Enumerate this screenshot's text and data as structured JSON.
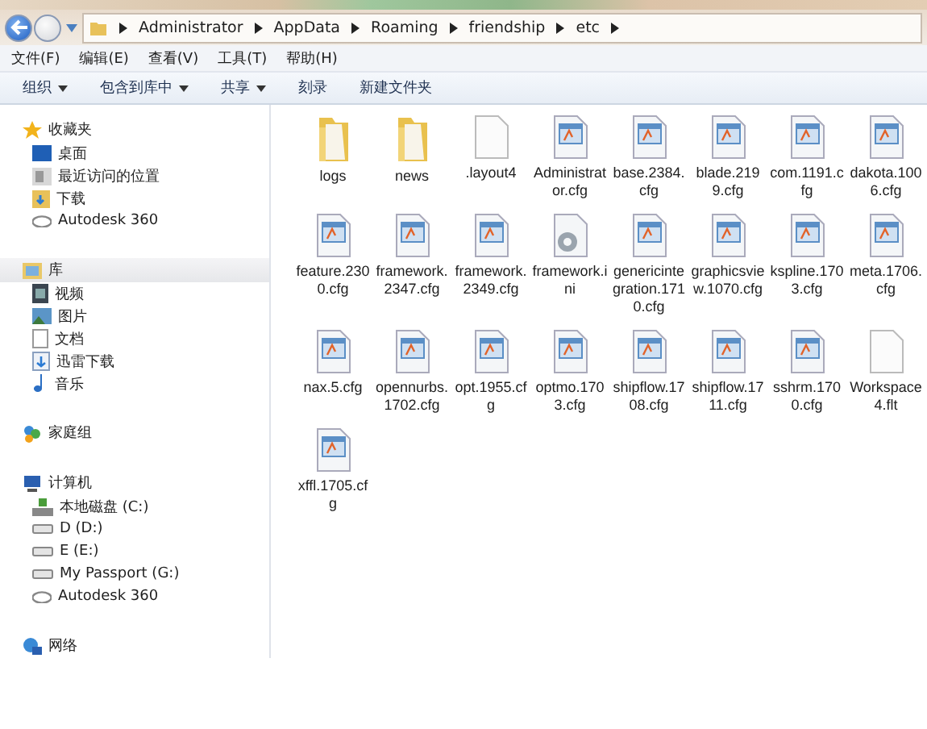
{
  "address_bar": {
    "segments": [
      "Administrator",
      "AppData",
      "Roaming",
      "friendship",
      "etc"
    ]
  },
  "menu_bar": [
    "文件(F)",
    "编辑(E)",
    "查看(V)",
    "工具(T)",
    "帮助(H)"
  ],
  "toolbar": [
    {
      "label": "组织",
      "dropdown": true
    },
    {
      "label": "包含到库中",
      "dropdown": true
    },
    {
      "label": "共享",
      "dropdown": true
    },
    {
      "label": "刻录",
      "dropdown": false
    },
    {
      "label": "新建文件夹",
      "dropdown": false
    }
  ],
  "sidebar": {
    "groups": [
      {
        "label": "收藏夹",
        "kind": "star",
        "selected": false,
        "children": [
          {
            "label": "桌面",
            "kind": "desktop"
          },
          {
            "label": "最近访问的位置",
            "kind": "recent"
          },
          {
            "label": "下载",
            "kind": "download"
          },
          {
            "label": "Autodesk 360",
            "kind": "cloud"
          }
        ]
      },
      {
        "label": "库",
        "kind": "library",
        "selected": true,
        "children": [
          {
            "label": "视频",
            "kind": "video"
          },
          {
            "label": "图片",
            "kind": "image"
          },
          {
            "label": "文档",
            "kind": "doc"
          },
          {
            "label": "迅雷下载",
            "kind": "download2"
          },
          {
            "label": "音乐",
            "kind": "music"
          }
        ]
      },
      {
        "label": "家庭组",
        "kind": "homegroup",
        "selected": false
      },
      {
        "label": "计算机",
        "kind": "computer",
        "selected": false,
        "children": [
          {
            "label": "本地磁盘 (C:)",
            "kind": "sysdrive"
          },
          {
            "label": "D (D:)",
            "kind": "drive"
          },
          {
            "label": "E (E:)",
            "kind": "drive"
          },
          {
            "label": "My Passport (G:)",
            "kind": "drive"
          },
          {
            "label": "Autodesk 360",
            "kind": "cloud"
          }
        ]
      },
      {
        "label": "网络",
        "kind": "network",
        "selected": false
      }
    ]
  },
  "files": [
    {
      "name": "logs",
      "kind": "folder"
    },
    {
      "name": "news",
      "kind": "folder"
    },
    {
      "name": ".layout4",
      "kind": "blank"
    },
    {
      "name": "Administrator.cfg",
      "kind": "cfg"
    },
    {
      "name": "base.2384.cfg",
      "kind": "cfg"
    },
    {
      "name": "blade.2199.cfg",
      "kind": "cfg"
    },
    {
      "name": "com.1191.cfg",
      "kind": "cfg"
    },
    {
      "name": "dakota.1006.cfg",
      "kind": "cfg"
    },
    {
      "name": "feature.2300.cfg",
      "kind": "cfg"
    },
    {
      "name": "framework.2347.cfg",
      "kind": "cfg"
    },
    {
      "name": "framework.2349.cfg",
      "kind": "cfg"
    },
    {
      "name": "framework.ini",
      "kind": "ini"
    },
    {
      "name": "genericintegration.1710.cfg",
      "kind": "cfg"
    },
    {
      "name": "graphicsview.1070.cfg",
      "kind": "cfg"
    },
    {
      "name": "kspline.1703.cfg",
      "kind": "cfg"
    },
    {
      "name": "meta.1706.cfg",
      "kind": "cfg"
    },
    {
      "name": "nax.5.cfg",
      "kind": "cfg"
    },
    {
      "name": "opennurbs.1702.cfg",
      "kind": "cfg"
    },
    {
      "name": "opt.1955.cfg",
      "kind": "cfg"
    },
    {
      "name": "optmo.1703.cfg",
      "kind": "cfg"
    },
    {
      "name": "shipflow.1708.cfg",
      "kind": "cfg"
    },
    {
      "name": "shipflow.1711.cfg",
      "kind": "cfg"
    },
    {
      "name": "sshrm.1700.cfg",
      "kind": "cfg"
    },
    {
      "name": "Workspace4.flt",
      "kind": "blank"
    },
    {
      "name": "xffl.1705.cfg",
      "kind": "cfg"
    }
  ]
}
